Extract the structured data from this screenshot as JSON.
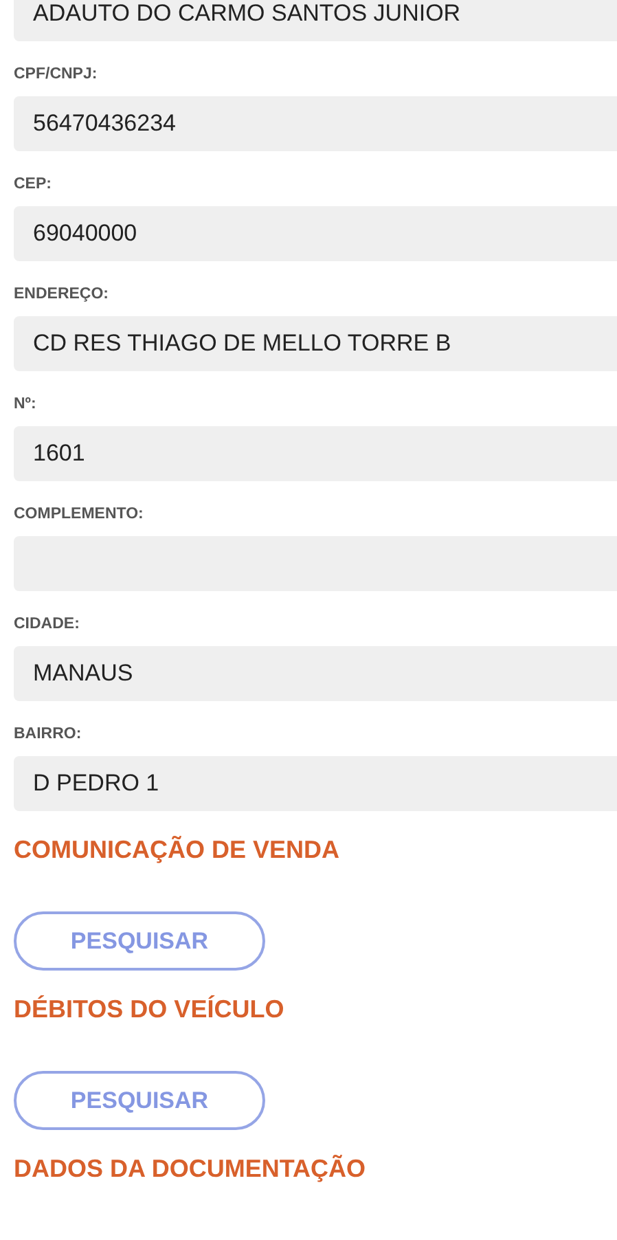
{
  "fields": [
    {
      "value": "ADAUTO DO CARMO SANTOS JUNIOR"
    },
    {
      "label": "CPF/CNPJ:",
      "value": "56470436234"
    },
    {
      "label": "CEP:",
      "value": "69040000"
    },
    {
      "label": "ENDEREÇO:",
      "value": "CD RES THIAGO DE MELLO TORRE B"
    },
    {
      "label": "Nº:",
      "value": "1601"
    },
    {
      "label": "COMPLEMENTO:"
    },
    {
      "label": "CIDADE:",
      "value": "MANAUS"
    },
    {
      "label": "BAIRRO:",
      "value": "D PEDRO 1"
    }
  ],
  "sections": [
    {
      "title": "COMUNICAÇÃO DE VENDA",
      "button": "PESQUISAR"
    },
    {
      "title": "DÉBITOS DO VEÍCULO",
      "button": "PESQUISAR"
    },
    {
      "title": "DADOS DA DOCUMENTAÇÃO"
    }
  ]
}
